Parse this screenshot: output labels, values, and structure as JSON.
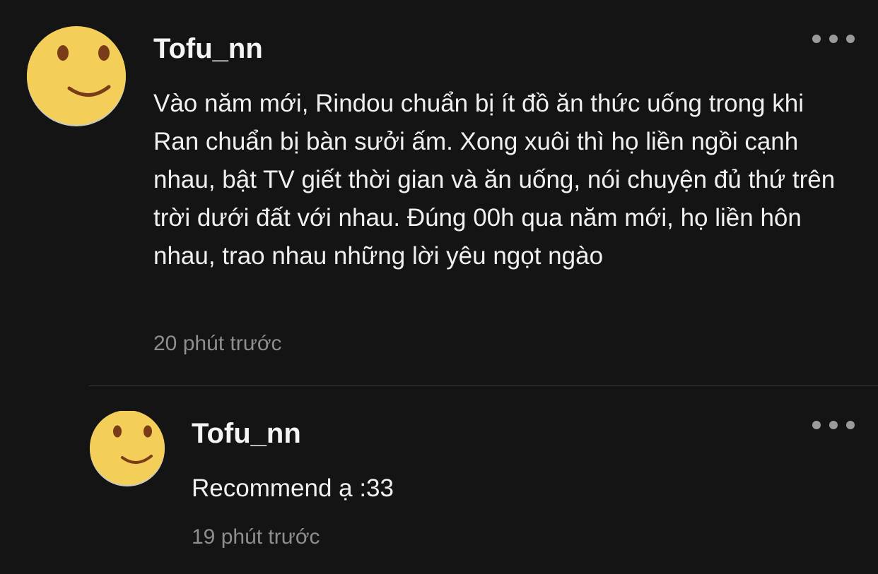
{
  "comments": [
    {
      "username": "Tofu_nn",
      "body": "Vào năm mới, Rindou chuẩn bị ít đồ ăn thức uống trong khi Ran chuẩn bị bàn sưởi ấm. Xong xuôi thì họ liền ngồi cạnh nhau, bật TV giết thời gian và ăn uống, nói chuyện đủ thứ trên trời dưới đất với nhau. Đúng 00h qua năm mới, họ liền hôn nhau, trao nhau những lời yêu ngọt ngào",
      "timestamp": "20 phút trước",
      "avatar_icon": "smiley-face-icon",
      "more_icon": "more-options-icon"
    },
    {
      "username": "Tofu_nn",
      "body": "Recommend ạ :33",
      "timestamp": "19 phút trước",
      "avatar_icon": "smiley-face-icon",
      "more_icon": "more-options-icon"
    }
  ],
  "colors": {
    "background": "#141414",
    "avatar_face": "#f3cf5a",
    "avatar_shade": "#c9c9c9",
    "avatar_features": "#7a3b18",
    "text": "#f0f0f0",
    "muted": "#8e8e8e",
    "divider": "#3a3a3a"
  }
}
